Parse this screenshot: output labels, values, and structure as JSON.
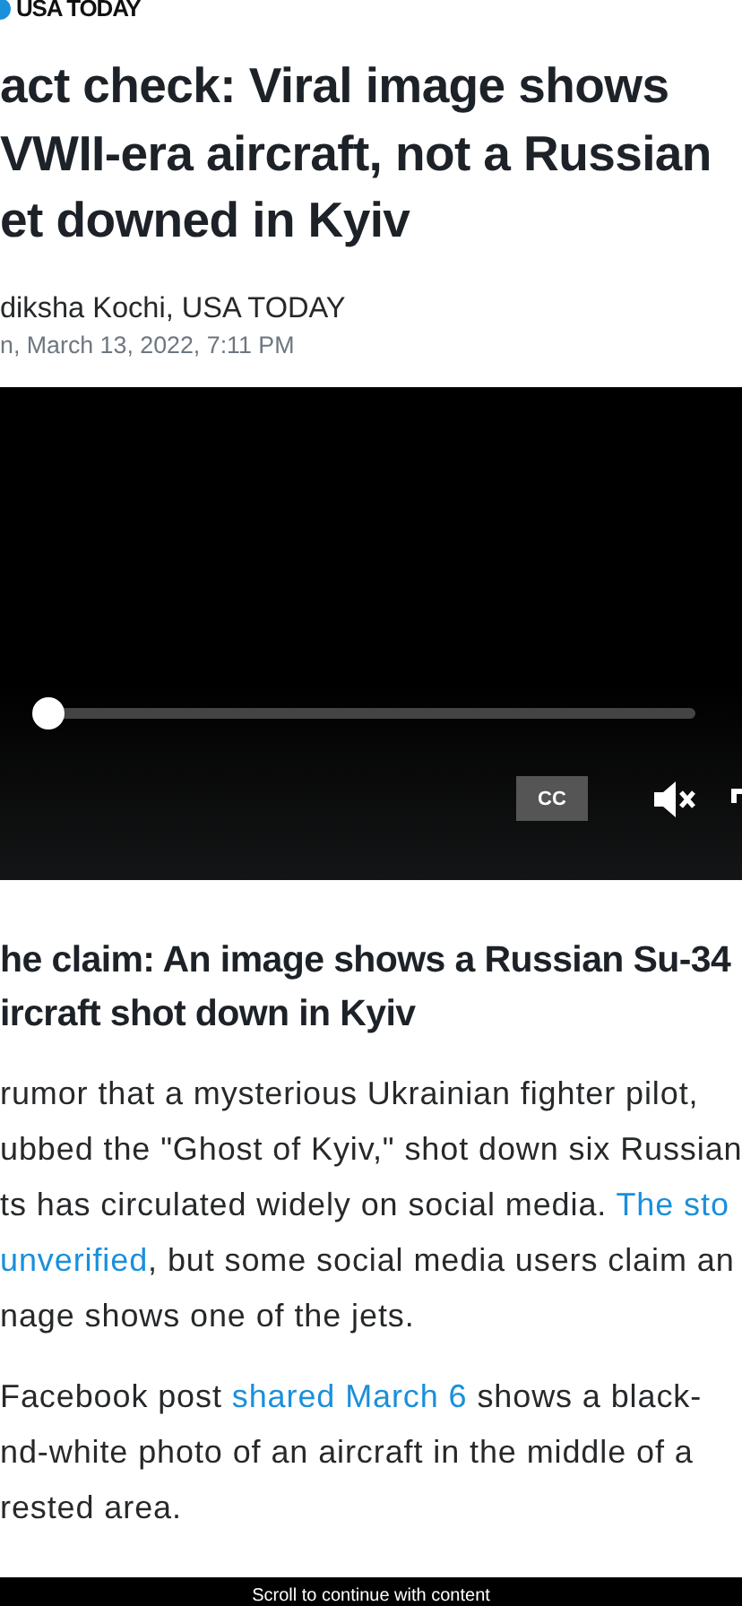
{
  "logo": {
    "text": "USA TODAY"
  },
  "headline": [
    "act check: Viral image shows",
    "VWII-era aircraft, not a Russian",
    "et downed in Kyiv"
  ],
  "byline": "diksha Kochi, USA TODAY",
  "date": "n, March 13, 2022, 7:11 PM",
  "video": {
    "progress": {
      "level": 0
    },
    "cc_label": "CC",
    "muted": true
  },
  "section_heading": [
    "he claim: An image shows a Russian Su-34",
    "ircraft shot down in Kyiv"
  ],
  "paragraphs": [
    [
      [
        {
          "text": "rumor that a mysterious Ukrainian fighter pilot,",
          "link": false
        }
      ],
      [
        {
          "text": "ubbed the \"Ghost of Kyiv,\" shot down six Russian",
          "link": false
        }
      ],
      [
        {
          "text": "ts has circulated widely on social media. ",
          "link": false
        },
        {
          "text": "The sto",
          "link": true
        }
      ],
      [
        {
          "text": "unverified",
          "link": true
        },
        {
          "text": ", but some social media users claim an",
          "link": false
        }
      ],
      [
        {
          "text": "nage shows one of the jets.",
          "link": false
        }
      ]
    ],
    [
      [
        {
          "text": "Facebook post ",
          "link": false
        },
        {
          "text": "shared March 6",
          "link": true
        },
        {
          "text": " shows a black-",
          "link": false
        }
      ],
      [
        {
          "text": "nd-white photo of an aircraft in the middle of a",
          "link": false
        }
      ],
      [
        {
          "text": "rested area.",
          "link": false
        }
      ]
    ]
  ],
  "bottom_bar": "Scroll to continue with content"
}
